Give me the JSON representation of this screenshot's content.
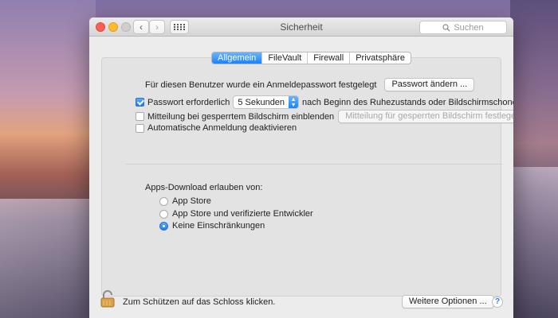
{
  "window": {
    "title": "Sicherheit"
  },
  "toolbar": {
    "search_placeholder": "Suchen",
    "back_glyph": "‹",
    "forward_glyph": "›"
  },
  "tabs": [
    {
      "label": "Allgemein",
      "active": true
    },
    {
      "label": "FileVault",
      "active": false
    },
    {
      "label": "Firewall",
      "active": false
    },
    {
      "label": "Privatsphäre",
      "active": false
    }
  ],
  "general": {
    "password_label": "Für diesen Benutzer wurde ein Anmeldepasswort festgelegt",
    "change_password_button": "Passwort ändern ...",
    "require_password": {
      "label": "Passwort erforderlich",
      "checked": true
    },
    "require_delay": "5 Sekunden",
    "require_suffix": "nach Beginn des Ruhezustands oder Bildschirmschoners",
    "lock_message": {
      "label": "Mitteilung bei gesperrtem Bildschirm einblenden",
      "checked": false
    },
    "lock_message_button": "Mitteilung für gesperrten Bildschirm festlegen ...",
    "auto_login": {
      "label": "Automatische Anmeldung deaktivieren",
      "checked": false
    }
  },
  "downloads": {
    "heading": "Apps-Download erlauben von:",
    "options": [
      {
        "label": "App Store",
        "selected": false
      },
      {
        "label": "App Store und verifizierte Entwickler",
        "selected": false
      },
      {
        "label": "Keine Einschränkungen",
        "selected": true
      }
    ]
  },
  "footer": {
    "lock_text": "Zum Schützen auf das Schloss klicken.",
    "advanced_button": "Weitere Optionen ...",
    "help_glyph": "?"
  },
  "colors": {
    "accent": "#1a82fb",
    "close": "#fc5f57",
    "minimize": "#fdbc2e"
  }
}
